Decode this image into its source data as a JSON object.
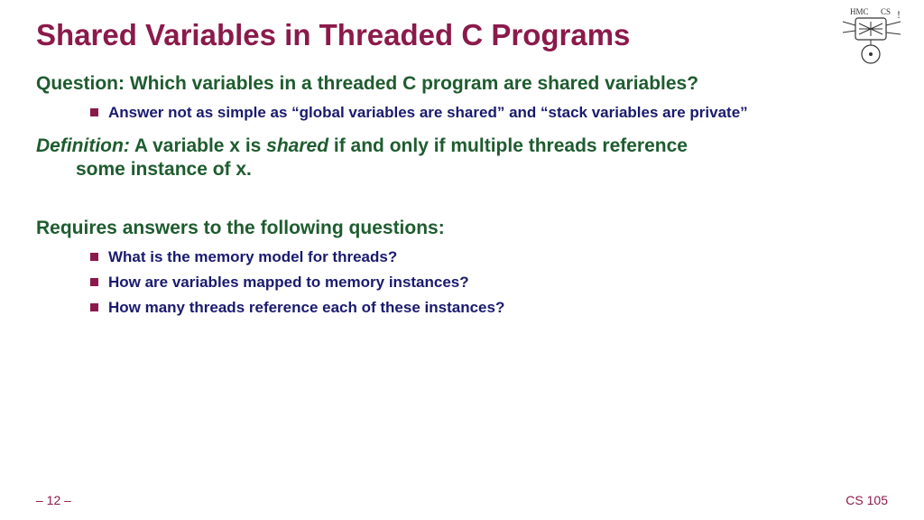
{
  "title": "Shared Variables in Threaded C Programs",
  "question": "Question: Which variables in a threaded C program are shared variables?",
  "answer_bullet": "Answer not as simple as “global variables are shared” and “stack variables are private”",
  "definition": {
    "label": "Definition:",
    "part1": " A variable x is ",
    "shared_word": "shared",
    "part2": " if and only if multiple threads reference",
    "cont": "some instance of x."
  },
  "requires_head": "Requires answers to the following questions:",
  "req_bullets": [
    "What is the memory model for threads?",
    "How are variables mapped to memory instances?",
    "How many threads reference each of these instances?"
  ],
  "footer": {
    "page": "– 12 –",
    "course": "CS 105"
  },
  "logo": {
    "label_left": "HMC",
    "label_right": "CS"
  }
}
